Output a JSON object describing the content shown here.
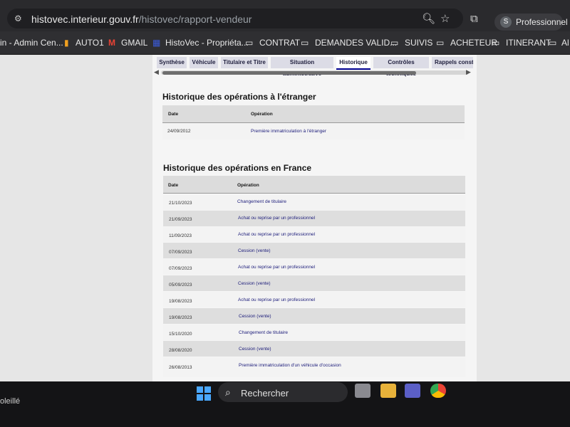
{
  "browser": {
    "url_host": "histovec.interieur.gouv.fr",
    "url_path": "/histovec/rapport-vendeur",
    "profile_initial": "S",
    "profile_label": "Professionnel"
  },
  "bookmarks": [
    {
      "label": "in - Admin Cen..."
    },
    {
      "label": "AUTO1"
    },
    {
      "label": "GMAIL"
    },
    {
      "label": "HistoVec - Propriéta..."
    },
    {
      "label": "CONTRAT"
    },
    {
      "label": "DEMANDES VALID..."
    },
    {
      "label": "SUIVIS"
    },
    {
      "label": "ACHETEUR"
    },
    {
      "label": "ITINERANT"
    },
    {
      "label": "Al"
    }
  ],
  "tabs": [
    {
      "label": "Synthèse"
    },
    {
      "label": "Véhicule"
    },
    {
      "label": "Titulaire et Titre"
    },
    {
      "label": "Situation administrative"
    },
    {
      "label": "Historique"
    },
    {
      "label": "Contrôles techniques"
    },
    {
      "label": "Rappels constru"
    }
  ],
  "foreign": {
    "title": "Historique des opérations à l'étranger",
    "col_date": "Date",
    "col_op": "Opération",
    "rows": [
      {
        "date": "24/09/2012",
        "op": "Première immatriculation à l'étranger"
      }
    ]
  },
  "france": {
    "title": "Historique des opérations en France",
    "col_date": "Date",
    "col_op": "Opération",
    "rows": [
      {
        "date": "21/10/2023",
        "op": "Changement de titulaire"
      },
      {
        "date": "21/09/2023",
        "op": "Achat ou reprise par un professionnel"
      },
      {
        "date": "11/09/2023",
        "op": "Achat ou reprise par un professionnel"
      },
      {
        "date": "07/09/2023",
        "op": "Cession (vente)"
      },
      {
        "date": "07/09/2023",
        "op": "Achat ou reprise par un professionnel"
      },
      {
        "date": "05/09/2023",
        "op": "Cession (vente)"
      },
      {
        "date": "19/08/2023",
        "op": "Achat ou reprise par un professionnel"
      },
      {
        "date": "19/08/2023",
        "op": "Cession (vente)"
      },
      {
        "date": "15/10/2020",
        "op": "Changement de titulaire"
      },
      {
        "date": "28/08/2020",
        "op": "Cession (vente)"
      },
      {
        "date": "26/08/2013",
        "op": "Première immatriculation d'un véhicule d'occasion"
      }
    ]
  },
  "taskbar": {
    "search_label": "Rechercher",
    "weather_text": "oleillé"
  },
  "colors": {
    "accent": "#000091",
    "link": "#1c1c7a"
  }
}
